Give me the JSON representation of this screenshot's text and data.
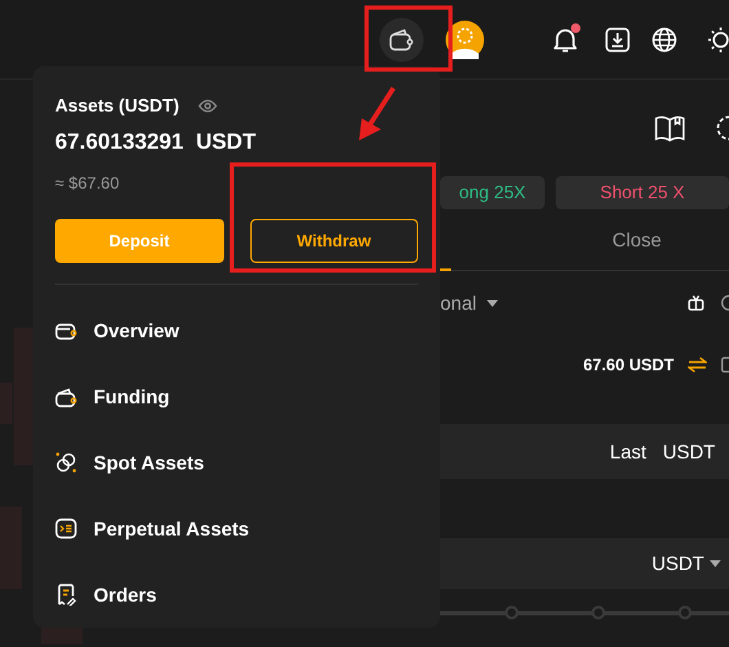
{
  "top_bar": {
    "notification_badge": true
  },
  "assets_panel": {
    "title": "Assets (USDT)",
    "amount": "67.60133291",
    "unit": "USDT",
    "fiat": "≈ $67.60",
    "buttons": [
      {
        "label": "Deposit",
        "kind": "primary"
      },
      {
        "label": "Withdraw",
        "kind": "outline"
      }
    ],
    "menu": [
      {
        "label": "Overview",
        "kind": "overview"
      },
      {
        "label": "Funding",
        "kind": "funding"
      },
      {
        "label": "Spot Assets",
        "kind": "spot"
      },
      {
        "label": "Perpetual Assets",
        "kind": "perpetual"
      },
      {
        "label": "Orders",
        "kind": "orders"
      }
    ]
  },
  "trade_panel": {
    "leverage_buttons": [
      {
        "label": "ong 25X",
        "kind": "long"
      },
      {
        "label": "Short 25 X",
        "kind": "short"
      }
    ],
    "tabs": [
      {
        "label": "Close",
        "selected": false
      }
    ],
    "order_type": "onal",
    "balance": "67.60 USDT",
    "price_labels": [
      "Last",
      "USDT"
    ],
    "amount_unit": "USDT",
    "amount_slider": {
      "level": 0
    }
  }
}
